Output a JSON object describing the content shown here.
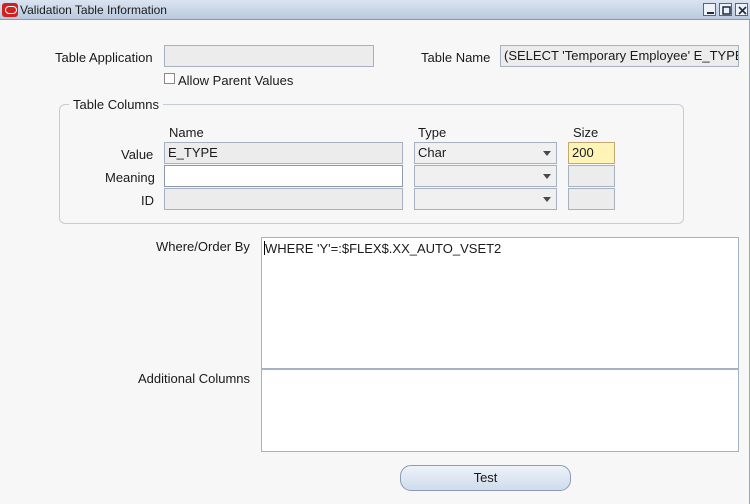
{
  "window": {
    "title": "Validation Table Information"
  },
  "header": {
    "table_application_label": "Table Application",
    "table_application_value": "",
    "table_name_label": "Table Name",
    "table_name_value": "(SELECT 'Temporary Employee' E_TYPE",
    "allow_parent_values_label": "Allow Parent Values",
    "allow_parent_values_checked": false
  },
  "table_columns": {
    "group_title": "Table Columns",
    "headers": {
      "name": "Name",
      "type": "Type",
      "size": "Size"
    },
    "rows": [
      {
        "label": "Value",
        "name": "E_TYPE",
        "type": "Char",
        "size": "200"
      },
      {
        "label": "Meaning",
        "name": "",
        "type": "",
        "size": ""
      },
      {
        "label": "ID",
        "name": "",
        "type": "",
        "size": ""
      }
    ]
  },
  "where_order_by": {
    "label": "Where/Order By",
    "value": "WHERE 'Y'=:$FLEX$.XX_AUTO_VSET2"
  },
  "additional_columns": {
    "label": "Additional Columns",
    "value": ""
  },
  "buttons": {
    "test_label": "Test"
  },
  "colors": {
    "title_bar": "#c8d5e7",
    "active_field": "#fff4b8",
    "oracle_icon": "#d21f1f"
  }
}
